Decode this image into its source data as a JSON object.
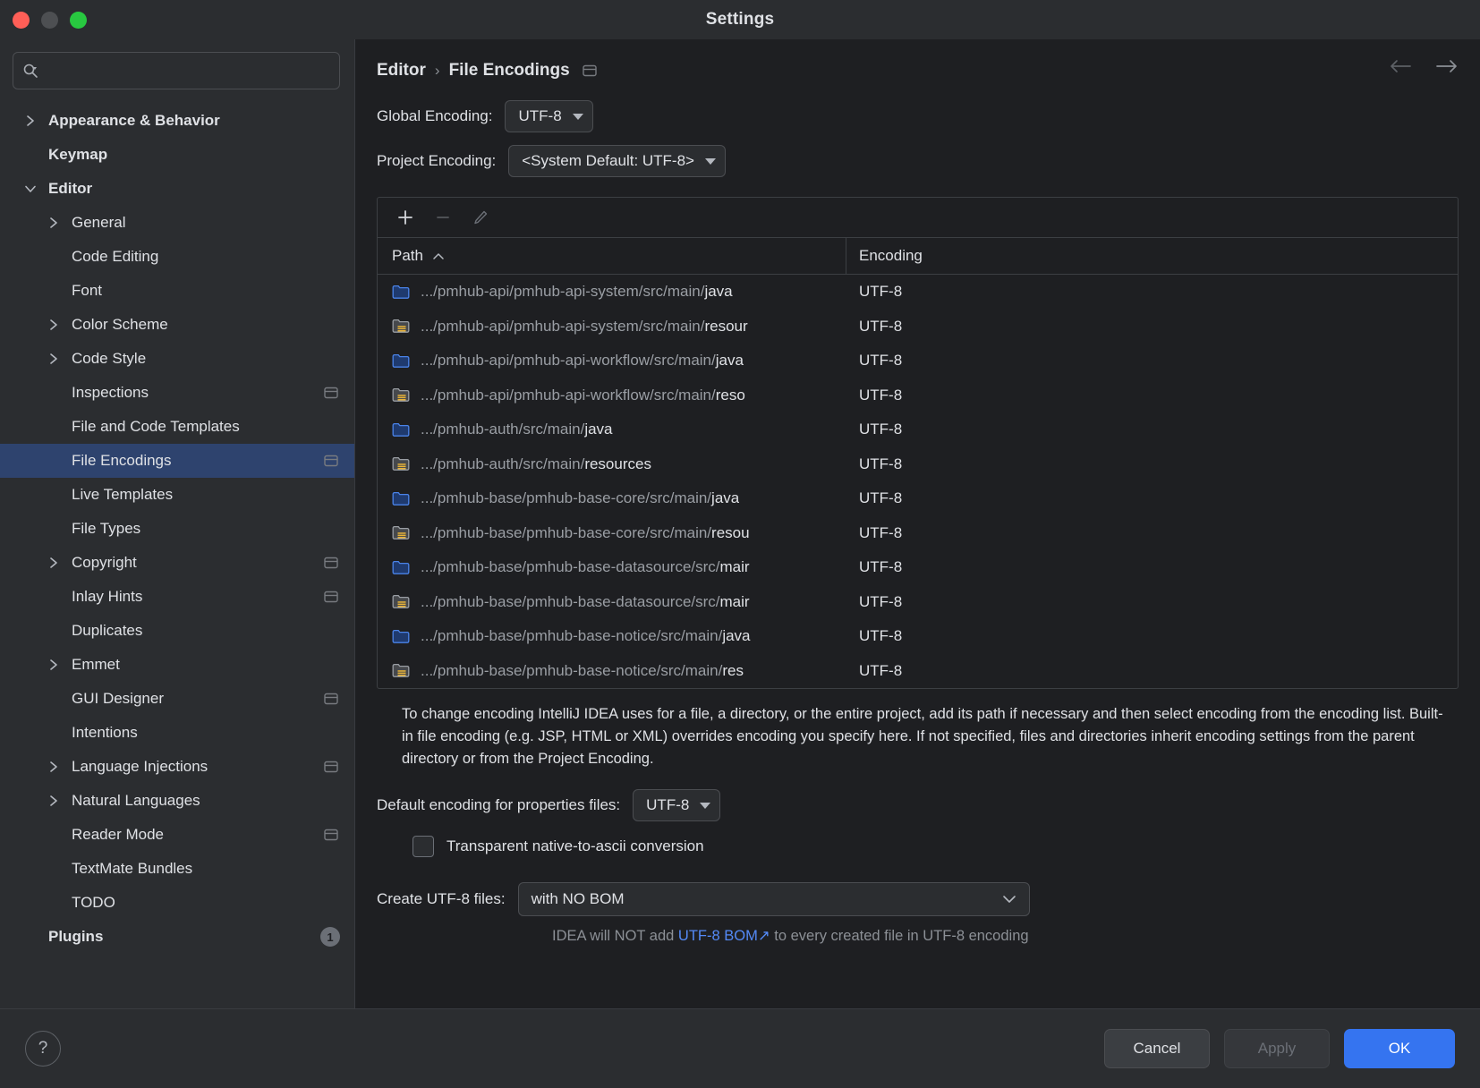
{
  "window": {
    "title": "Settings",
    "traffic_lights": [
      "close",
      "minimize",
      "zoom"
    ]
  },
  "search": {
    "value": "",
    "placeholder": ""
  },
  "sidebar": {
    "items": [
      {
        "label": "Appearance & Behavior",
        "level": 0,
        "arrow": "collapsed",
        "bold": true,
        "badge": false,
        "selected": false
      },
      {
        "label": "Keymap",
        "level": 0,
        "arrow": "none",
        "bold": true,
        "badge": false,
        "selected": false
      },
      {
        "label": "Editor",
        "level": 0,
        "arrow": "expanded",
        "bold": true,
        "badge": false,
        "selected": false
      },
      {
        "label": "General",
        "level": 1,
        "arrow": "collapsed",
        "bold": false,
        "badge": false,
        "selected": false
      },
      {
        "label": "Code Editing",
        "level": 1,
        "arrow": "none",
        "bold": false,
        "badge": false,
        "selected": false
      },
      {
        "label": "Font",
        "level": 1,
        "arrow": "none",
        "bold": false,
        "badge": false,
        "selected": false
      },
      {
        "label": "Color Scheme",
        "level": 1,
        "arrow": "collapsed",
        "bold": false,
        "badge": false,
        "selected": false
      },
      {
        "label": "Code Style",
        "level": 1,
        "arrow": "collapsed",
        "bold": false,
        "badge": false,
        "selected": false
      },
      {
        "label": "Inspections",
        "level": 1,
        "arrow": "none",
        "bold": false,
        "badge": true,
        "selected": false
      },
      {
        "label": "File and Code Templates",
        "level": 1,
        "arrow": "none",
        "bold": false,
        "badge": false,
        "selected": false
      },
      {
        "label": "File Encodings",
        "level": 1,
        "arrow": "none",
        "bold": false,
        "badge": true,
        "selected": true
      },
      {
        "label": "Live Templates",
        "level": 1,
        "arrow": "none",
        "bold": false,
        "badge": false,
        "selected": false
      },
      {
        "label": "File Types",
        "level": 1,
        "arrow": "none",
        "bold": false,
        "badge": false,
        "selected": false
      },
      {
        "label": "Copyright",
        "level": 1,
        "arrow": "collapsed",
        "bold": false,
        "badge": true,
        "selected": false
      },
      {
        "label": "Inlay Hints",
        "level": 1,
        "arrow": "none",
        "bold": false,
        "badge": true,
        "selected": false
      },
      {
        "label": "Duplicates",
        "level": 1,
        "arrow": "none",
        "bold": false,
        "badge": false,
        "selected": false
      },
      {
        "label": "Emmet",
        "level": 1,
        "arrow": "collapsed",
        "bold": false,
        "badge": false,
        "selected": false
      },
      {
        "label": "GUI Designer",
        "level": 1,
        "arrow": "none",
        "bold": false,
        "badge": true,
        "selected": false
      },
      {
        "label": "Intentions",
        "level": 1,
        "arrow": "none",
        "bold": false,
        "badge": false,
        "selected": false
      },
      {
        "label": "Language Injections",
        "level": 1,
        "arrow": "collapsed",
        "bold": false,
        "badge": true,
        "selected": false
      },
      {
        "label": "Natural Languages",
        "level": 1,
        "arrow": "collapsed",
        "bold": false,
        "badge": false,
        "selected": false
      },
      {
        "label": "Reader Mode",
        "level": 1,
        "arrow": "none",
        "bold": false,
        "badge": true,
        "selected": false
      },
      {
        "label": "TextMate Bundles",
        "level": 1,
        "arrow": "none",
        "bold": false,
        "badge": false,
        "selected": false
      },
      {
        "label": "TODO",
        "level": 1,
        "arrow": "none",
        "bold": false,
        "badge": false,
        "selected": false
      },
      {
        "label": "Plugins",
        "level": 0,
        "arrow": "none",
        "bold": true,
        "badge": false,
        "selected": false,
        "count": "1"
      }
    ]
  },
  "breadcrumb": {
    "parent": "Editor",
    "separator": "›",
    "current": "File Encodings"
  },
  "settings": {
    "global_encoding_label": "Global Encoding:",
    "global_encoding_value": "UTF-8",
    "project_encoding_label": "Project Encoding:",
    "project_encoding_value": "<System Default: UTF-8>"
  },
  "table": {
    "toolbar": {
      "add": "+",
      "remove": "−",
      "edit": "pencil"
    },
    "columns": {
      "path": "Path",
      "encoding": "Encoding"
    },
    "sort_indicator": "⌃",
    "rows": [
      {
        "icon": "folder",
        "prefix": ".../pmhub-api/pmhub-api-system/src/main/",
        "name": "java",
        "encoding": "UTF-8"
      },
      {
        "icon": "folder-resources",
        "prefix": ".../pmhub-api/pmhub-api-system/src/main/",
        "name": "resour",
        "encoding": "UTF-8"
      },
      {
        "icon": "folder",
        "prefix": ".../pmhub-api/pmhub-api-workflow/src/main/",
        "name": "java",
        "encoding": "UTF-8"
      },
      {
        "icon": "folder-resources",
        "prefix": ".../pmhub-api/pmhub-api-workflow/src/main/",
        "name": "reso",
        "encoding": "UTF-8"
      },
      {
        "icon": "folder",
        "prefix": ".../pmhub-auth/src/main/",
        "name": "java",
        "encoding": "UTF-8"
      },
      {
        "icon": "folder-resources",
        "prefix": ".../pmhub-auth/src/main/",
        "name": "resources",
        "encoding": "UTF-8"
      },
      {
        "icon": "folder",
        "prefix": ".../pmhub-base/pmhub-base-core/src/main/",
        "name": "java",
        "encoding": "UTF-8"
      },
      {
        "icon": "folder-resources",
        "prefix": ".../pmhub-base/pmhub-base-core/src/main/",
        "name": "resou",
        "encoding": "UTF-8"
      },
      {
        "icon": "folder",
        "prefix": ".../pmhub-base/pmhub-base-datasource/src/",
        "name": "mair",
        "encoding": "UTF-8"
      },
      {
        "icon": "folder-resources",
        "prefix": ".../pmhub-base/pmhub-base-datasource/src/",
        "name": "mair",
        "encoding": "UTF-8"
      },
      {
        "icon": "folder",
        "prefix": ".../pmhub-base/pmhub-base-notice/src/main/",
        "name": "java",
        "encoding": "UTF-8"
      },
      {
        "icon": "folder-resources",
        "prefix": ".../pmhub-base/pmhub-base-notice/src/main/",
        "name": "res",
        "encoding": "UTF-8"
      }
    ]
  },
  "description": "To change encoding IntelliJ IDEA uses for a file, a directory, or the entire project, add its path if necessary and then select encoding from the encoding list. Built-in file encoding (e.g. JSP, HTML or XML) overrides encoding you specify here. If not specified, files and directories inherit encoding settings from the parent directory or from the Project Encoding.",
  "properties": {
    "default_encoding_label": "Default encoding for properties files:",
    "default_encoding_value": "UTF-8",
    "transparent_label": "Transparent native-to-ascii conversion",
    "transparent_checked": false
  },
  "bom": {
    "label": "Create UTF-8 files:",
    "value": "with NO BOM",
    "hint_prefix": "IDEA will NOT add ",
    "hint_link": "UTF-8 BOM",
    "hint_link_arrow": "↗",
    "hint_suffix": " to every created file in UTF-8 encoding"
  },
  "footer": {
    "help": "?",
    "cancel": "Cancel",
    "apply": "Apply",
    "ok": "OK"
  },
  "colors": {
    "accent": "#3574f0",
    "selection": "#2e436e",
    "link": "#548af7",
    "folder_blue": "#3b74d6",
    "sidebar_bg": "#2b2d30",
    "main_bg": "#1e1f22"
  }
}
